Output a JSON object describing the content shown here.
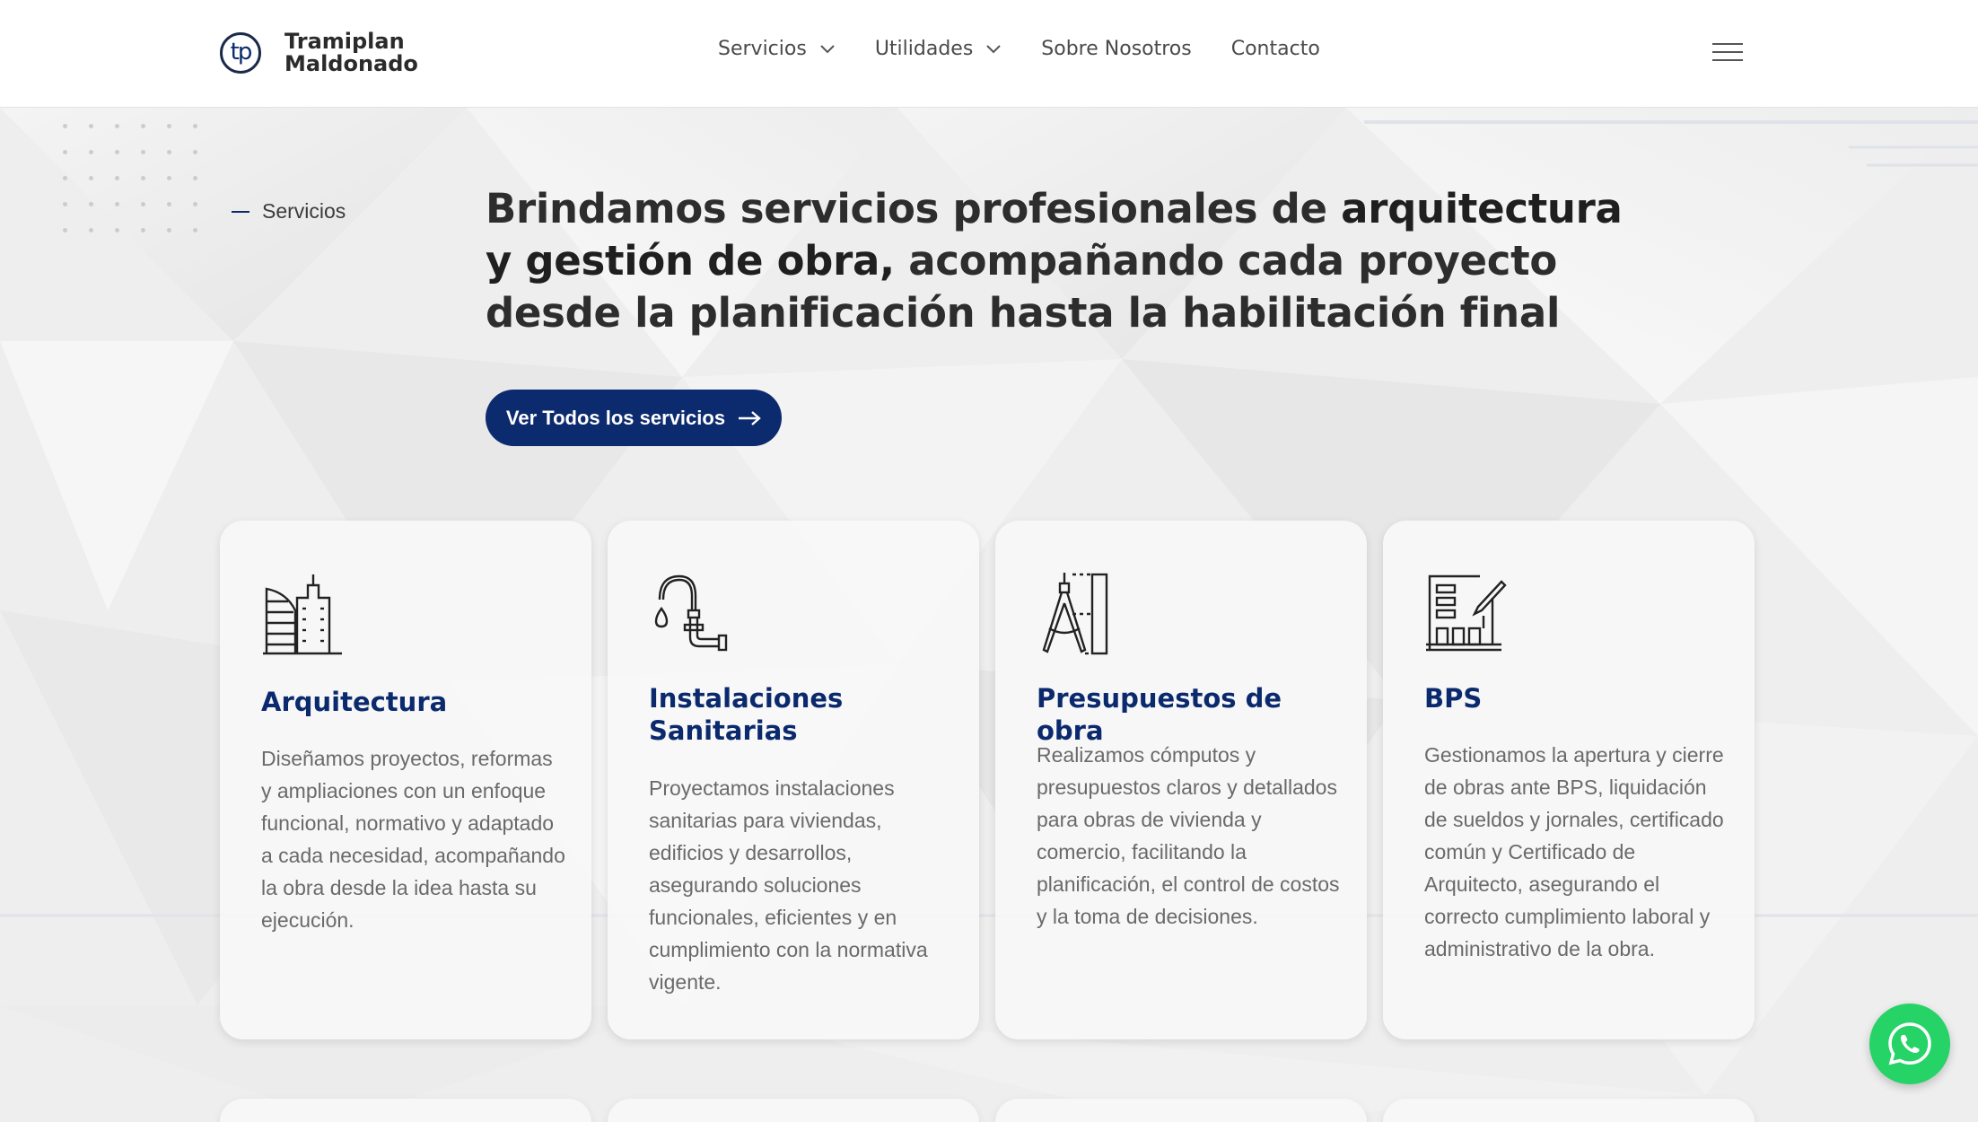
{
  "brand": {
    "line1": "Tramiplan",
    "line2": "Maldonado",
    "mark": "tp"
  },
  "nav": {
    "items": [
      {
        "label": "Servicios",
        "dropdown": true
      },
      {
        "label": "Utilidades",
        "dropdown": true
      },
      {
        "label": "Sobre Nosotros",
        "dropdown": false
      },
      {
        "label": "Contacto",
        "dropdown": false
      }
    ]
  },
  "hero": {
    "eyebrow": "Servicios",
    "headline_part1": "Brindamos servicios profesionales de ",
    "headline_bold": "arquitectura y gestión de obra,",
    "headline_part2": " acompañando cada proyecto desde la planificación hasta la habilitación final",
    "cta_label": "Ver Todos los servicios"
  },
  "cards": [
    {
      "title": "Arquitectura",
      "icon": "buildings-icon",
      "text": "Diseñamos proyectos, reformas y ampliaciones con un enfoque funcional, normativo y adaptado a cada necesidad, acompañando la obra desde la idea hasta su ejecución."
    },
    {
      "title": "Instalaciones Sanitarias",
      "icon": "faucet-pipe-icon",
      "text": "Proyectamos instalaciones sanitarias para viviendas, edificios y desarrollos, asegurando soluciones funcionales, eficientes y en cumplimiento con la normativa vigente."
    },
    {
      "title": "Presupuestos de obra",
      "icon": "compass-ruler-icon",
      "text": "Realizamos cómputos y presupuestos claros y detallados para obras de vivienda y comercio, facilitando la planificación, el control de costos y la toma de decisiones."
    },
    {
      "title": "BPS",
      "icon": "building-plan-icon",
      "text": "Gestionamos la apertura y cierre de obras ante BPS, liquidación de sueldos y jornales, certificado común y Certificado de Arquitecto, asegurando el correcto cumplimiento laboral y administrativo de la obra."
    }
  ],
  "colors": {
    "primary": "#0c2a6e",
    "whatsapp": "#25d366",
    "text": "#6a6a6a"
  }
}
